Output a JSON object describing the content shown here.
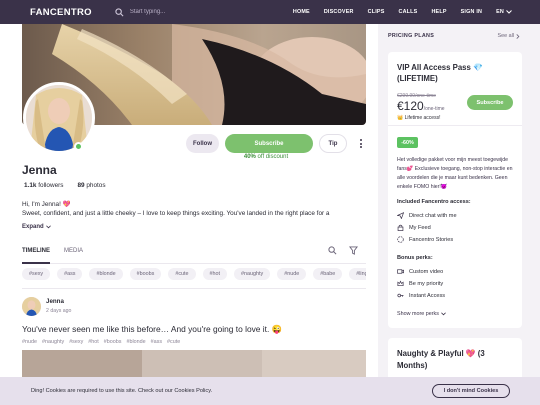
{
  "header": {
    "logo": "FANCENTRO",
    "search_placeholder": "Start typing...",
    "nav": [
      "HOME",
      "DISCOVER",
      "CLIPS",
      "CALLS",
      "HELP",
      "SIGN IN"
    ],
    "language": "EN"
  },
  "profile": {
    "name": "Jenna",
    "followers_count": "1.1k",
    "followers_label": "followers",
    "photos_count": "89",
    "photos_label": "photos",
    "follow_label": "Follow",
    "subscribe_label": "Subscribe",
    "tip_label": "Tip",
    "discount_value": "40%",
    "discount_label": "off discount",
    "bio_line1": "Hi, I'm Jenna! 💖",
    "bio_line2": "Sweet, confident, and just a little cheeky – I love to keep things exciting. You've landed in the right place for a",
    "expand_label": "Expand"
  },
  "tabs": [
    "TIMELINE",
    "MEDIA"
  ],
  "tags": [
    "#sexy",
    "#ass",
    "#blonde",
    "#boobs",
    "#cute",
    "#hot",
    "#naughty",
    "#nude",
    "#babe",
    "#lingerie"
  ],
  "post": {
    "author": "Jenna",
    "time": "2 days ago",
    "text": "You've never seen me like this before… And you're going to love it. 😜",
    "tags": [
      "#nude",
      "#naughty",
      "#sexy",
      "#hot",
      "#boobs",
      "#blonde",
      "#ass",
      "#cute"
    ]
  },
  "sidebar": {
    "title": "PRICING PLANS",
    "see_all": "See all",
    "plan": {
      "title": "VIP All Access Pass 💎 (LIFETIME)",
      "old_price": "€299.99/one-time",
      "price": "€120",
      "price_suffix": "/one-time",
      "subscribe_label": "Subscribe",
      "access_note": "👑 Lifetime access!",
      "discount_badge": "-60%",
      "description": "Het volledige pakket voor mijn meest toegewijde fans💕 Exclusieve toegang, non-stop interactie en alle voordelen die je maar kunt bedenken. Geen enkele FOMO hier!😈",
      "includes_title": "Included Fancentro access:",
      "includes": [
        "Direct chat with me",
        "My Feed",
        "Fancentro Stories"
      ],
      "bonus_title": "Bonus perks:",
      "bonus": [
        "Custom video",
        "Be my priority",
        "Instant Access"
      ],
      "show_more": "Show more perks"
    },
    "card2_title": "Naughty & Playful 💖 (3 Months)"
  },
  "cookie": {
    "text": "Ding! Cookies are required to use this site. Check out our Cookies Policy.",
    "button": "I don't mind Cookies"
  },
  "colors": {
    "topbar": "#3a3249",
    "accent_green": "#7dc16e",
    "badge_green": "#5cc261",
    "sidebar_bg": "#f4f2f6"
  }
}
